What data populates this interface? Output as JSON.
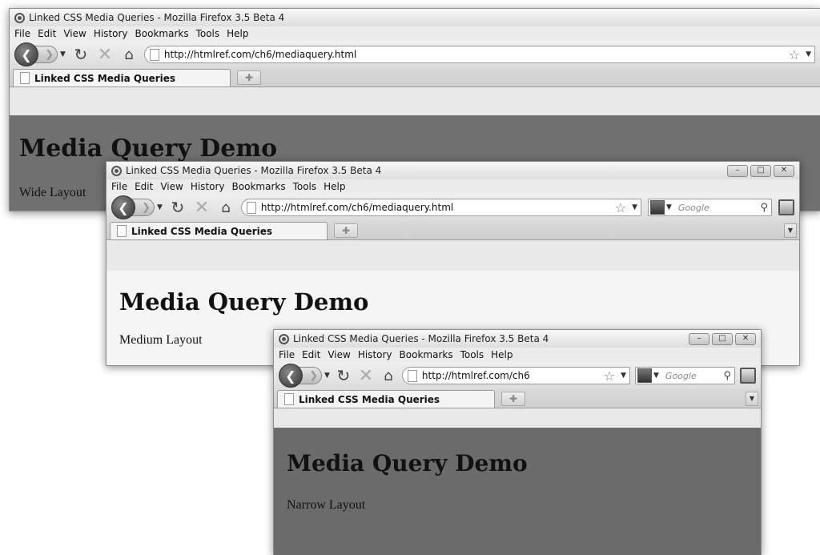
{
  "windows": [
    {
      "title": "Linked CSS Media Queries - Mozilla Firefox 3.5 Beta 4",
      "menu": [
        "File",
        "Edit",
        "View",
        "History",
        "Bookmarks",
        "Tools",
        "Help"
      ],
      "url": "http://htmlref.com/ch6/mediaquery.html",
      "tab_label": "Linked CSS Media Queries",
      "heading": "Media Query Demo",
      "layout_text": "Wide Layout"
    },
    {
      "title": "Linked CSS Media Queries - Mozilla Firefox 3.5 Beta 4",
      "menu": [
        "File",
        "Edit",
        "View",
        "History",
        "Bookmarks",
        "Tools",
        "Help"
      ],
      "url": "http://htmlref.com/ch6/mediaquery.html",
      "search_placeholder": "Google",
      "tab_label": "Linked CSS Media Queries",
      "heading": "Media Query Demo",
      "layout_text": "Medium Layout"
    },
    {
      "title": "Linked CSS Media Queries - Mozilla Firefox 3.5 Beta 4",
      "menu": [
        "File",
        "Edit",
        "View",
        "History",
        "Bookmarks",
        "Tools",
        "Help"
      ],
      "url": "http://htmlref.com/ch6",
      "search_placeholder": "Google",
      "tab_label": "Linked CSS Media Queries",
      "heading": "Media Query Demo",
      "layout_text": "Narrow Layout"
    }
  ],
  "icons": {
    "back": "back-arrow-icon",
    "forward": "forward-arrow-icon",
    "reload": "reload-icon",
    "stop": "stop-icon",
    "home": "home-icon",
    "bookmark": "star-icon",
    "search": "magnifier-icon",
    "new_tab": "new-tab-icon"
  },
  "colors": {
    "wide_bg": "#707070",
    "medium_bg": "#f5f5f5",
    "narrow_bg": "#6b6b6b"
  }
}
